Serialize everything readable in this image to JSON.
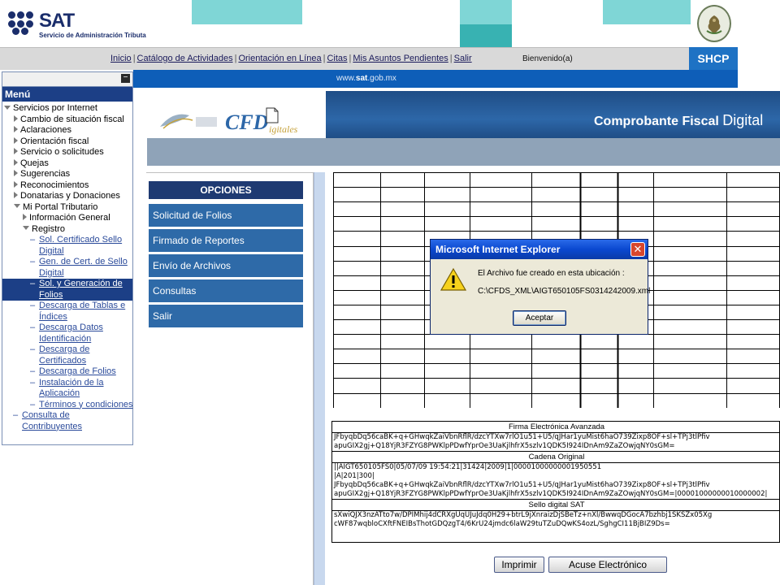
{
  "header": {
    "logo_name": "SAT",
    "logo_sub": "Servicio de Administración Tributaria"
  },
  "nav": {
    "links": [
      "Inicio",
      "Catálogo de Actividades",
      "Orientación en Línea",
      "Citas",
      "Mis Asuntos Pendientes",
      "Salir"
    ],
    "welcome": "Bienvenido(a)",
    "shcp": "SHCP"
  },
  "urlbar": {
    "prefix": "www.",
    "domain": "sat",
    "suffix": ".gob.mx"
  },
  "sidebar": {
    "minus": "−",
    "title": "Menú",
    "root": "Servicios por Internet",
    "items": [
      "Cambio de situación fiscal",
      "Aclaraciones",
      "Orientación fiscal",
      "Servicio o solicitudes",
      "Quejas",
      "Sugerencias",
      "Reconocimientos",
      "Donatarias y Donaciones"
    ],
    "portal": "Mi Portal Tributario",
    "info": "Información General",
    "registro": "Registro",
    "links": [
      "Sol. Certificado Sello Digital",
      "Gen. de Cert. de Sello Digital",
      "Sol. y Generación de Folios",
      "Descarga de Tablas e Índices",
      "Descarga Datos Identificación",
      "Descarga de Certificados",
      "Descarga de Folios",
      "Instalación de la Aplicación",
      "Términos y condiciones"
    ],
    "consulta": "Consulta de Contribuyentes"
  },
  "banner": {
    "cfd": "CFD",
    "cfd_sub": "igitales",
    "title_a": "Comprobante Fiscal ",
    "title_b": "Digital"
  },
  "options": {
    "title": "OPCIONES",
    "items": [
      "Solicitud de Folios",
      "Firmado de Reportes",
      "Envío de Archivos",
      "Consultas",
      "Salir"
    ]
  },
  "lower": {
    "h1": "Firma Electrónica Avanzada",
    "f1": "JFbyqbDq56caBK+q+GHwqkZaiVbnRflR/dzcYTXw7rlO1u51+U5/qJHar1yuMist6haO739Zixp8OF+sl+TPj3tlPfiv",
    "f2": "apuGIX2gj+Q18YjR3FZYG8PWKlpPDwfYprOe3UaKjlhfrX5szlv1QDK5I924IDnAm9ZaZOwjqNY0sGM=",
    "h2": "Cadena Original",
    "c1": "||AIGT650105FS0|05/07/09 19:54:21|31424|2009|1|00001000000001950551",
    "c2": "|A|201|300|",
    "c3": "JFbyqbDq56caBK+q+GHwqkZaiVbnRflR/dzcYTXw7rlO1u51+U5/qJHar1yuMist6haO739Zixp8OF+sl+TPj3tlPfiv",
    "c4": "apuGIX2gj+Q18YjR3FZYG8PWKlpPDwfYprOe3UaKjlhfrX5szlv1QDK5I924IDnAm9ZaZOwjqNY0sGM=|00001000000010000002|",
    "h3": "Sello digital SAT",
    "s1": "sXwiQJX3nzATto7w/DPIMhij4dCRXgUqUJuJdq0H29+btrL9jXnraizDjSBeTz+nXl/BwwqDGocA7bzhbj1SKSZx05Xg",
    "s2": "cWF87wqbloCXftFNEIBsThotGDQzgT4/6KrU24jmdc6laW29tuTZuDQwKS4ozL/SghgCI11BjBIZ9Ds="
  },
  "buttons": {
    "print": "Imprimir",
    "acuse": "Acuse Electrónico"
  },
  "dialog": {
    "title": "Microsoft Internet Explorer",
    "close": "✕",
    "message": "El Archivo fue creado en esta ubicación :",
    "path": "C:\\CFDS_XML\\AIGT650105FS0314242009.xml",
    "ok": "Aceptar"
  }
}
